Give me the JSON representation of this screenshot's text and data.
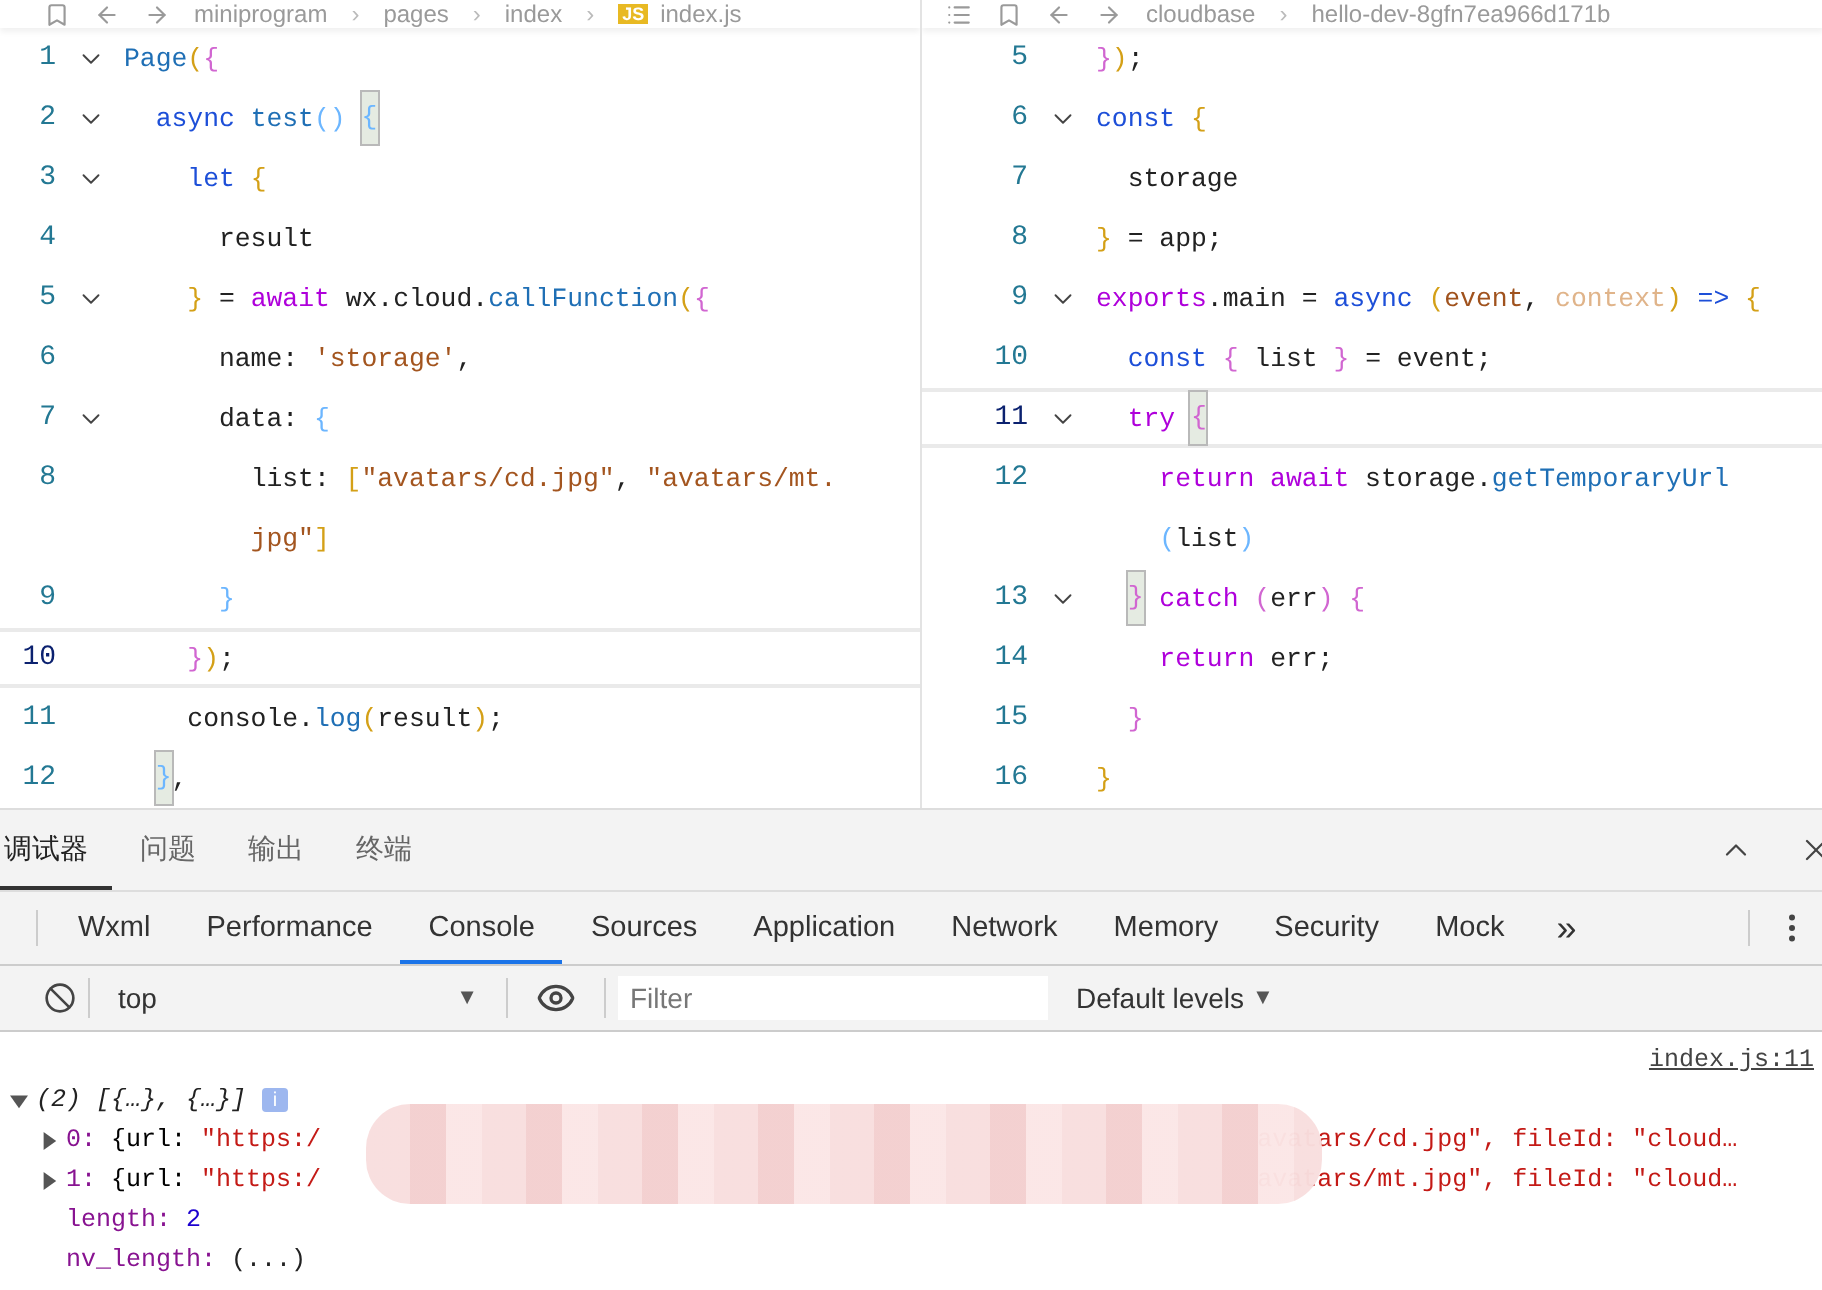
{
  "editors": [
    {
      "outline_button": false,
      "separator": "›",
      "breadcrumb": [
        "miniprogram",
        "pages",
        "index",
        "index.js"
      ],
      "file_badge": "JS",
      "lines": [
        {
          "number": "1",
          "foldable": true,
          "current": false,
          "rows": [
            {
              "tokens": [
                {
                  "text": "Page",
                  "color": "#1f6fb5"
                },
                {
                  "text": "(",
                  "color": "#d4a017"
                },
                {
                  "text": "{",
                  "color": "#d166d1"
                }
              ]
            }
          ]
        },
        {
          "number": "2",
          "foldable": true,
          "current": false,
          "rows": [
            {
              "tokens": [
                {
                  "text": "  async ",
                  "color": "#1d4fd8"
                },
                {
                  "text": "test",
                  "color": "#1f6fb5"
                },
                {
                  "text": "() ",
                  "color": "#6cb6ff"
                },
                {
                  "text": "{",
                  "color": "#6cb6ff",
                  "matched": true
                }
              ]
            }
          ]
        },
        {
          "number": "3",
          "foldable": true,
          "current": false,
          "rows": [
            {
              "tokens": [
                {
                  "text": "    let ",
                  "color": "#1d4fd8"
                },
                {
                  "text": "{",
                  "color": "#d4a017"
                }
              ]
            }
          ]
        },
        {
          "number": "4",
          "foldable": false,
          "current": false,
          "rows": [
            {
              "tokens": [
                {
                  "text": "      result",
                  "color": "#222222"
                }
              ]
            }
          ]
        },
        {
          "number": "5",
          "foldable": true,
          "current": false,
          "rows": [
            {
              "tokens": [
                {
                  "text": "    }",
                  "color": "#d4a017"
                },
                {
                  "text": " = ",
                  "color": "#222222"
                },
                {
                  "text": "await",
                  "color": "#af00db"
                },
                {
                  "text": " wx.cloud.",
                  "color": "#222222"
                },
                {
                  "text": "callFunction",
                  "color": "#1f6fb5"
                },
                {
                  "text": "(",
                  "color": "#d4a017"
                },
                {
                  "text": "{",
                  "color": "#d166d1"
                }
              ]
            }
          ]
        },
        {
          "number": "6",
          "foldable": false,
          "current": false,
          "rows": [
            {
              "tokens": [
                {
                  "text": "      name: ",
                  "color": "#222222"
                },
                {
                  "text": "'storage'",
                  "color": "#a3551f"
                },
                {
                  "text": ",",
                  "color": "#222222"
                }
              ]
            }
          ]
        },
        {
          "number": "7",
          "foldable": true,
          "current": false,
          "rows": [
            {
              "tokens": [
                {
                  "text": "      data: ",
                  "color": "#222222"
                },
                {
                  "text": "{",
                  "color": "#6cb6ff"
                }
              ]
            }
          ]
        },
        {
          "number": "8",
          "foldable": false,
          "current": false,
          "rows": [
            {
              "tokens": [
                {
                  "text": "        list: ",
                  "color": "#222222"
                },
                {
                  "text": "[",
                  "color": "#d4a017"
                },
                {
                  "text": "\"avatars/cd.jpg\"",
                  "color": "#a3551f"
                },
                {
                  "text": ", ",
                  "color": "#222222"
                },
                {
                  "text": "\"avatars/mt.",
                  "color": "#a3551f"
                }
              ]
            },
            {
              "tokens": [
                {
                  "text": "        jpg\"",
                  "color": "#a3551f"
                },
                {
                  "text": "]",
                  "color": "#d4a017"
                }
              ]
            }
          ]
        },
        {
          "number": "9",
          "foldable": false,
          "current": false,
          "rows": [
            {
              "tokens": [
                {
                  "text": "      }",
                  "color": "#6cb6ff"
                }
              ]
            }
          ]
        },
        {
          "number": "10",
          "foldable": false,
          "current": true,
          "rows": [
            {
              "tokens": [
                {
                  "text": "    }",
                  "color": "#d166d1"
                },
                {
                  "text": ")",
                  "color": "#d4a017"
                },
                {
                  "text": ";",
                  "color": "#222222"
                }
              ]
            }
          ]
        },
        {
          "number": "11",
          "foldable": false,
          "current": false,
          "rows": [
            {
              "tokens": [
                {
                  "text": "    console.",
                  "color": "#222222"
                },
                {
                  "text": "log",
                  "color": "#1f6fb5"
                },
                {
                  "text": "(",
                  "color": "#d4a017"
                },
                {
                  "text": "result",
                  "color": "#222222"
                },
                {
                  "text": ")",
                  "color": "#d4a017"
                },
                {
                  "text": ";",
                  "color": "#222222"
                }
              ]
            }
          ]
        },
        {
          "number": "12",
          "foldable": false,
          "current": false,
          "rows": [
            {
              "tokens": [
                {
                  "text": "  }",
                  "color": "#6cb6ff",
                  "matched": true
                },
                {
                  "text": ",",
                  "color": "#222222"
                }
              ]
            }
          ]
        }
      ]
    },
    {
      "outline_button": true,
      "separator": "›",
      "breadcrumb": [
        "cloudbase",
        "hello-dev-8gfn7ea966d171b"
      ],
      "lines": [
        {
          "number": "5",
          "foldable": false,
          "current": false,
          "rows": [
            {
              "tokens": [
                {
                  "text": "}",
                  "color": "#d166d1"
                },
                {
                  "text": ")",
                  "color": "#d4a017"
                },
                {
                  "text": ";",
                  "color": "#222222"
                }
              ]
            }
          ]
        },
        {
          "number": "6",
          "foldable": true,
          "current": false,
          "rows": [
            {
              "tokens": [
                {
                  "text": "const ",
                  "color": "#1d4fd8"
                },
                {
                  "text": "{",
                  "color": "#d4a017"
                }
              ]
            }
          ]
        },
        {
          "number": "7",
          "foldable": false,
          "current": false,
          "rows": [
            {
              "tokens": [
                {
                  "text": "  storage",
                  "color": "#222222"
                }
              ]
            }
          ]
        },
        {
          "number": "8",
          "foldable": false,
          "current": false,
          "rows": [
            {
              "tokens": [
                {
                  "text": "}",
                  "color": "#d4a017"
                },
                {
                  "text": " = app;",
                  "color": "#222222"
                }
              ]
            }
          ]
        },
        {
          "number": "9",
          "foldable": true,
          "current": false,
          "rows": [
            {
              "tokens": [
                {
                  "text": "exports",
                  "color": "#af00db"
                },
                {
                  "text": ".main = ",
                  "color": "#222222"
                },
                {
                  "text": "async ",
                  "color": "#1d4fd8"
                },
                {
                  "text": "(",
                  "color": "#d4a017"
                },
                {
                  "text": "event",
                  "color": "#a0521d"
                },
                {
                  "text": ", ",
                  "color": "#222222"
                },
                {
                  "text": "context",
                  "color": "#e0b48a"
                },
                {
                  "text": ")",
                  "color": "#d4a017"
                },
                {
                  "text": " => ",
                  "color": "#1d4fd8"
                },
                {
                  "text": "{",
                  "color": "#d4a017"
                }
              ]
            }
          ]
        },
        {
          "number": "10",
          "foldable": false,
          "current": false,
          "rows": [
            {
              "tokens": [
                {
                  "text": "  const ",
                  "color": "#1d4fd8"
                },
                {
                  "text": "{",
                  "color": "#d166d1"
                },
                {
                  "text": " list ",
                  "color": "#222222"
                },
                {
                  "text": "}",
                  "color": "#d166d1"
                },
                {
                  "text": " = event;",
                  "color": "#222222"
                }
              ]
            }
          ]
        },
        {
          "number": "11",
          "foldable": true,
          "current": true,
          "rows": [
            {
              "tokens": [
                {
                  "text": "  try ",
                  "color": "#af00db"
                },
                {
                  "text": "{",
                  "color": "#d166d1",
                  "matched": true
                }
              ]
            }
          ]
        },
        {
          "number": "12",
          "foldable": false,
          "current": false,
          "rows": [
            {
              "tokens": [
                {
                  "text": "    return await",
                  "color": "#af00db"
                },
                {
                  "text": " storage.",
                  "color": "#222222"
                },
                {
                  "text": "getTemporaryUrl",
                  "color": "#1f6fb5"
                }
              ]
            },
            {
              "tokens": [
                {
                  "text": "    (",
                  "color": "#6cb6ff"
                },
                {
                  "text": "list",
                  "color": "#222222"
                },
                {
                  "text": ")",
                  "color": "#6cb6ff"
                }
              ]
            }
          ]
        },
        {
          "number": "13",
          "foldable": true,
          "current": false,
          "rows": [
            {
              "tokens": [
                {
                  "text": "  }",
                  "color": "#d166d1",
                  "matched": true
                },
                {
                  "text": " catch ",
                  "color": "#af00db"
                },
                {
                  "text": "(",
                  "color": "#d166d1"
                },
                {
                  "text": "err",
                  "color": "#222222"
                },
                {
                  "text": ") {",
                  "color": "#d166d1"
                }
              ]
            }
          ]
        },
        {
          "number": "14",
          "foldable": false,
          "current": false,
          "rows": [
            {
              "tokens": [
                {
                  "text": "    return",
                  "color": "#af00db"
                },
                {
                  "text": " err;",
                  "color": "#222222"
                }
              ]
            }
          ]
        },
        {
          "number": "15",
          "foldable": false,
          "current": false,
          "rows": [
            {
              "tokens": [
                {
                  "text": "  }",
                  "color": "#d166d1"
                }
              ]
            }
          ]
        },
        {
          "number": "16",
          "foldable": false,
          "current": false,
          "rows": [
            {
              "tokens": [
                {
                  "text": "}",
                  "color": "#d4a017"
                }
              ]
            }
          ]
        }
      ]
    }
  ],
  "panel_tabs": [
    {
      "label": "调试器",
      "selected": true
    },
    {
      "label": "问题",
      "selected": false
    },
    {
      "label": "输出",
      "selected": false
    },
    {
      "label": "终端",
      "selected": false
    }
  ],
  "devtools_tabs": [
    {
      "label": "Wxml",
      "selected": false
    },
    {
      "label": "Performance",
      "selected": false
    },
    {
      "label": "Console",
      "selected": true
    },
    {
      "label": "Sources",
      "selected": false
    },
    {
      "label": "Application",
      "selected": false
    },
    {
      "label": "Network",
      "selected": false
    },
    {
      "label": "Memory",
      "selected": false
    },
    {
      "label": "Security",
      "selected": false
    },
    {
      "label": "Mock",
      "selected": false
    }
  ],
  "devtools_more": "»",
  "console_toolbar": {
    "context": "top",
    "context_caret": "▼",
    "filter_placeholder": "Filter",
    "levels": "Default levels",
    "levels_caret": "▼"
  },
  "console": {
    "source": "index.js:11",
    "summary": "(2) [{…}, {…}]",
    "expanded": true,
    "info_badge": "i",
    "redacted": true,
    "items": [
      {
        "key": "0:",
        "open": "{url: ",
        "url_start": "\"https:/",
        "suffix": "avatars/cd.jpg\", fileId: \"cloud…",
        "expanded": false
      },
      {
        "key": "1:",
        "open": "{url: ",
        "url_start": "\"https:/",
        "suffix": "avatars/mt.jpg\", fileId: \"cloud…",
        "expanded": false
      }
    ],
    "properties": [
      {
        "key": "length:",
        "value": "2",
        "kind": "number"
      },
      {
        "key": "nv_length:",
        "value": "(...)",
        "kind": "getter"
      }
    ]
  }
}
